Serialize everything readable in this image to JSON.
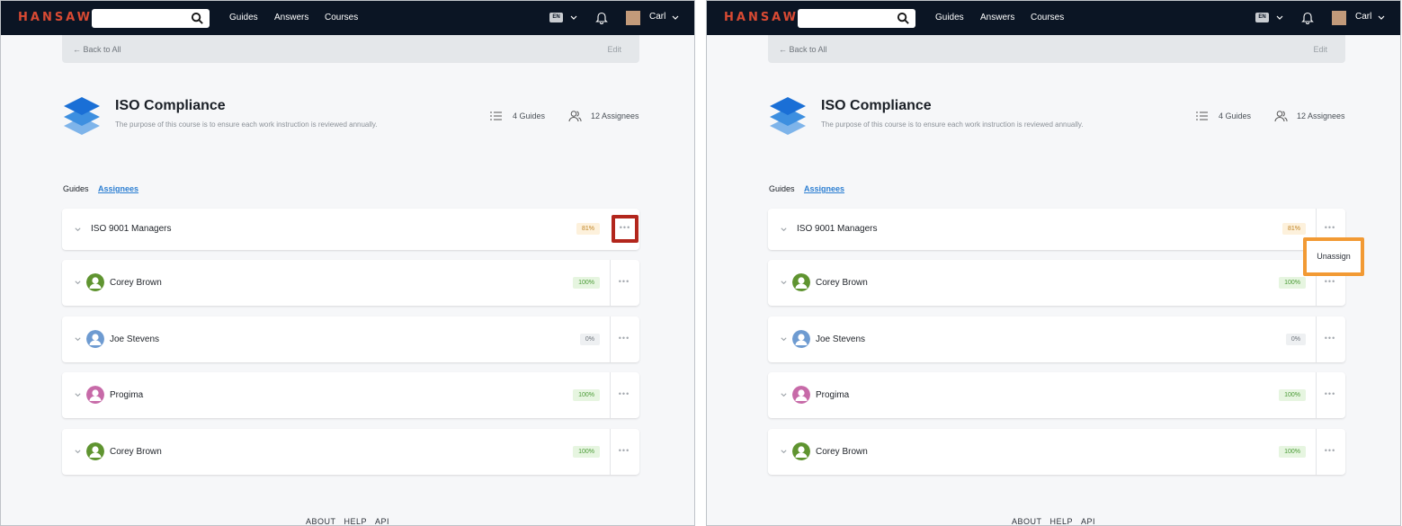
{
  "app": {
    "logo": "HANSAW",
    "nav": [
      "Guides",
      "Answers",
      "Courses"
    ],
    "lang": "EN",
    "user": "Carl"
  },
  "back": {
    "label": "← Back to All",
    "edit": "Edit"
  },
  "course": {
    "title": "ISO Compliance",
    "description": "The purpose of this course is to ensure each work instruction is reviewed annually.",
    "guides": "4 Guides",
    "assignees": "12 Assignees"
  },
  "tabs": {
    "guides": "Guides",
    "assignees": "Assignees"
  },
  "rows": [
    {
      "name": "ISO 9001 Managers",
      "pct": "81%",
      "type": "group"
    },
    {
      "name": "Corey Brown",
      "pct": "100%",
      "avatar_color": "#5f9430"
    },
    {
      "name": "Joe Stevens",
      "pct": "0%",
      "avatar_color": "#6e9bd1"
    },
    {
      "name": "Progima",
      "pct": "100%",
      "avatar_color": "#c76aa8"
    },
    {
      "name": "Corey Brown",
      "pct": "100%",
      "avatar_color": "#5f9430"
    }
  ],
  "menu": {
    "unassign": "Unassign"
  },
  "footer": [
    "ABOUT",
    "HELP",
    "API"
  ],
  "colors": {
    "brand": "#d94a33",
    "topbar": "#0b1524",
    "accent": "#2d7fd2",
    "highlight_red": "#b2261c",
    "highlight_orange": "#f29a34"
  }
}
